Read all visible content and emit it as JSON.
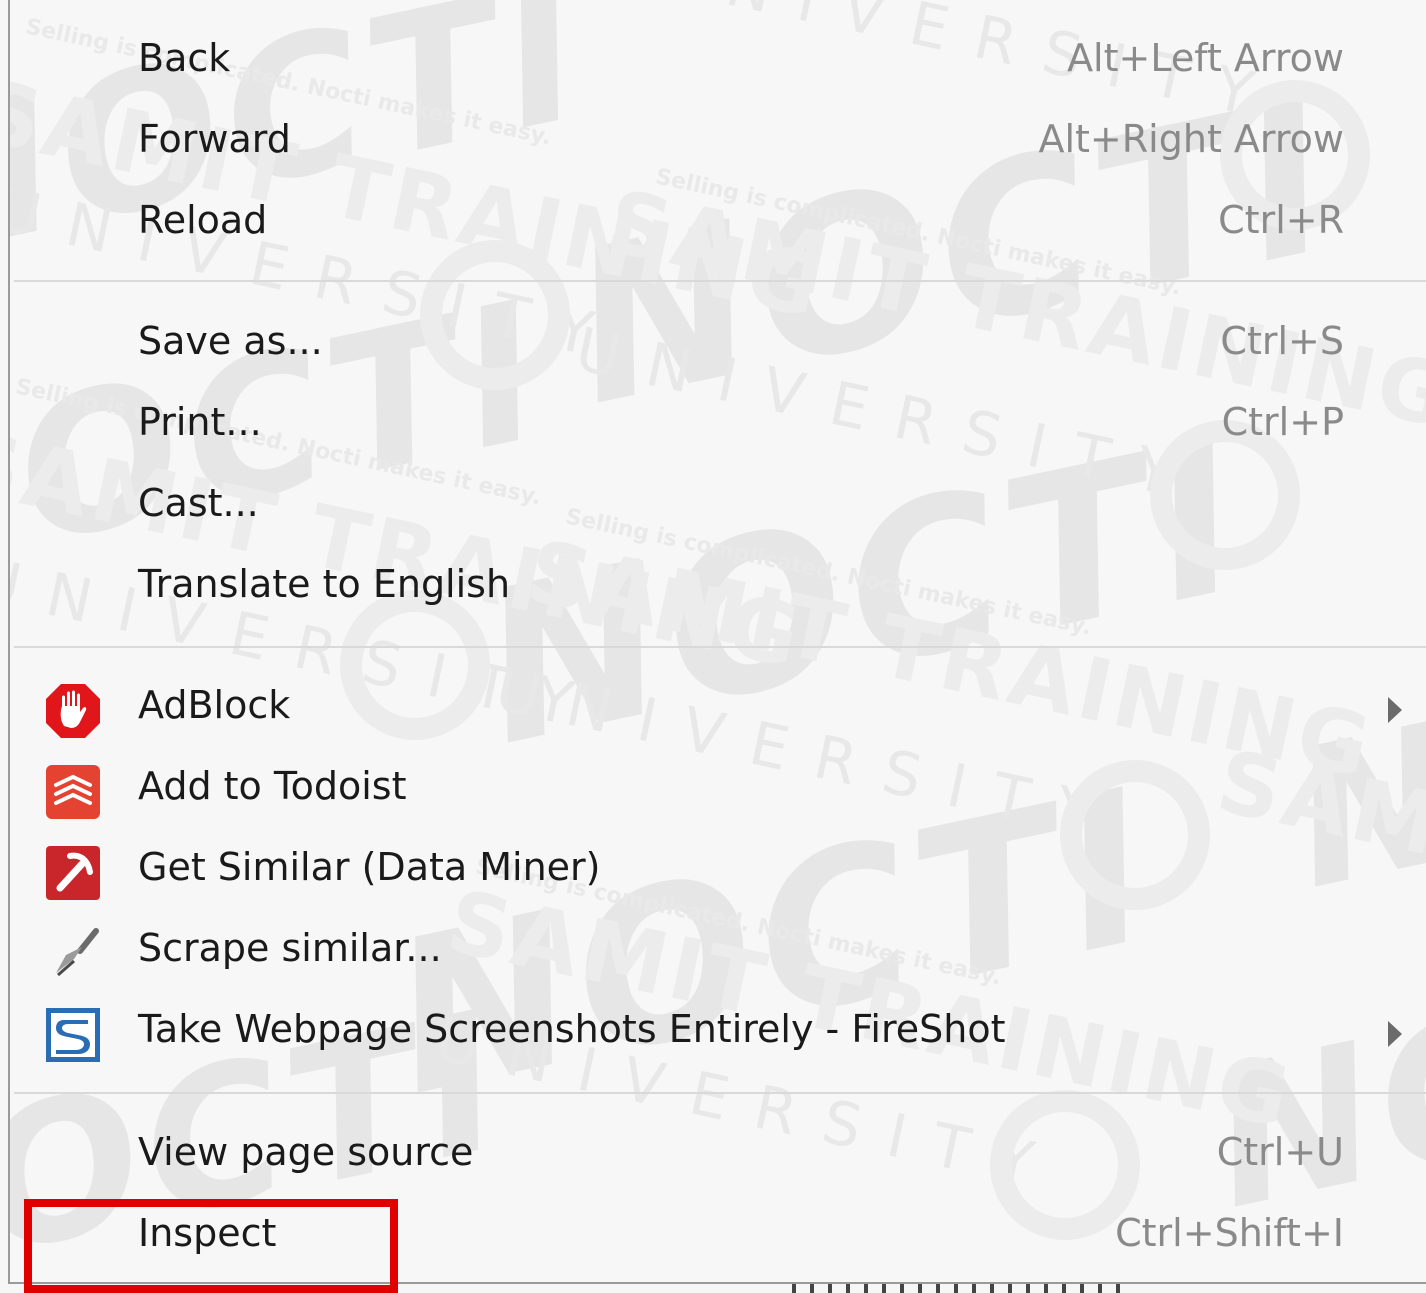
{
  "background": {
    "accent_teal": "#8dc7c8"
  },
  "watermark": {
    "brand": "NOCTI",
    "program": "SAMIT TRAINING",
    "university": "UNIVERSITY",
    "tagline": "Selling is complicated. Nocti makes it easy."
  },
  "menu": {
    "groups": [
      {
        "items": [
          {
            "label": "Back",
            "shortcut": "Alt+Left Arrow"
          },
          {
            "label": "Forward",
            "shortcut": "Alt+Right Arrow"
          },
          {
            "label": "Reload",
            "shortcut": "Ctrl+R"
          }
        ]
      },
      {
        "items": [
          {
            "label": "Save as...",
            "shortcut": "Ctrl+S"
          },
          {
            "label": "Print...",
            "shortcut": "Ctrl+P"
          },
          {
            "label": "Cast...",
            "shortcut": ""
          },
          {
            "label": "Translate to English",
            "shortcut": ""
          }
        ]
      },
      {
        "items": [
          {
            "label": "AdBlock",
            "icon": "adblock-icon",
            "submenu": true
          },
          {
            "label": "Add to Todoist",
            "icon": "todoist-icon"
          },
          {
            "label": "Get Similar (Data Miner)",
            "icon": "data-miner-icon"
          },
          {
            "label": "Scrape similar...",
            "icon": "scraper-icon"
          },
          {
            "label": "Take Webpage Screenshots Entirely - FireShot",
            "icon": "fireshot-icon",
            "submenu": true
          }
        ]
      },
      {
        "items": [
          {
            "label": "View page source",
            "shortcut": "Ctrl+U"
          },
          {
            "label": "Inspect",
            "shortcut": "Ctrl+Shift+I",
            "highlighted": true
          }
        ]
      }
    ]
  },
  "colors": {
    "highlight_border": "#e00000",
    "adblock_red": "#e0161b",
    "todoist_red": "#e44332",
    "data_miner_red": "#c9262c",
    "fireshot_blue": "#2a6db5"
  }
}
